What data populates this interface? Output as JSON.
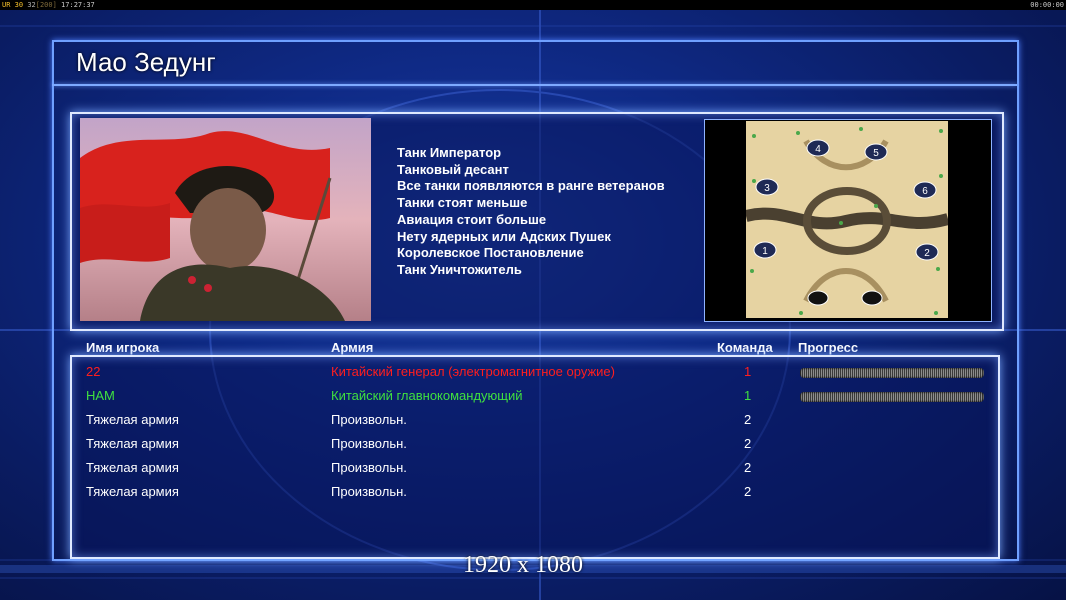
{
  "topbar": {
    "left_prefix": "UR",
    "fps_a": "30",
    "fps_b": "32",
    "fps_c": "[200]",
    "clock": "17:27:37",
    "right": "00:00:00"
  },
  "map_info": {
    "title": "Мао Зедунг",
    "features": [
      "Танк Император",
      "Танковый десант",
      "Все танки появляются в ранге ветеранов",
      "Танки стоят меньше",
      "Авиация стоит больше",
      "Нету ядерных или Адских Пушек",
      "Королевское Постановление",
      "Танк Уничтожитель"
    ]
  },
  "minimap": {
    "start_positions": [
      "1",
      "2",
      "3",
      "4",
      "5",
      "6"
    ]
  },
  "players_table": {
    "headers": {
      "name": "Имя игрока",
      "army": "Армия",
      "team": "Команда",
      "progress": "Прогресс"
    },
    "rows": [
      {
        "name": "22",
        "army": "Китайский генерал (электромагнитное оружие)",
        "team": "1",
        "color": "#ff1e1e",
        "has_progress": true
      },
      {
        "name": "HAM",
        "army": "Китайский главнокомандующий",
        "team": "1",
        "color": "#3fe03f",
        "has_progress": true
      },
      {
        "name": "Тяжелая армия",
        "army": "Произвольн.",
        "team": "2",
        "color": "#ffffff",
        "has_progress": false
      },
      {
        "name": "Тяжелая армия",
        "army": "Произвольн.",
        "team": "2",
        "color": "#ffffff",
        "has_progress": false
      },
      {
        "name": "Тяжелая армия",
        "army": "Произвольн.",
        "team": "2",
        "color": "#ffffff",
        "has_progress": false
      },
      {
        "name": "Тяжелая армия",
        "army": "Произвольн.",
        "team": "2",
        "color": "#ffffff",
        "has_progress": false
      }
    ]
  },
  "resolution_label": "1920 x 1080"
}
